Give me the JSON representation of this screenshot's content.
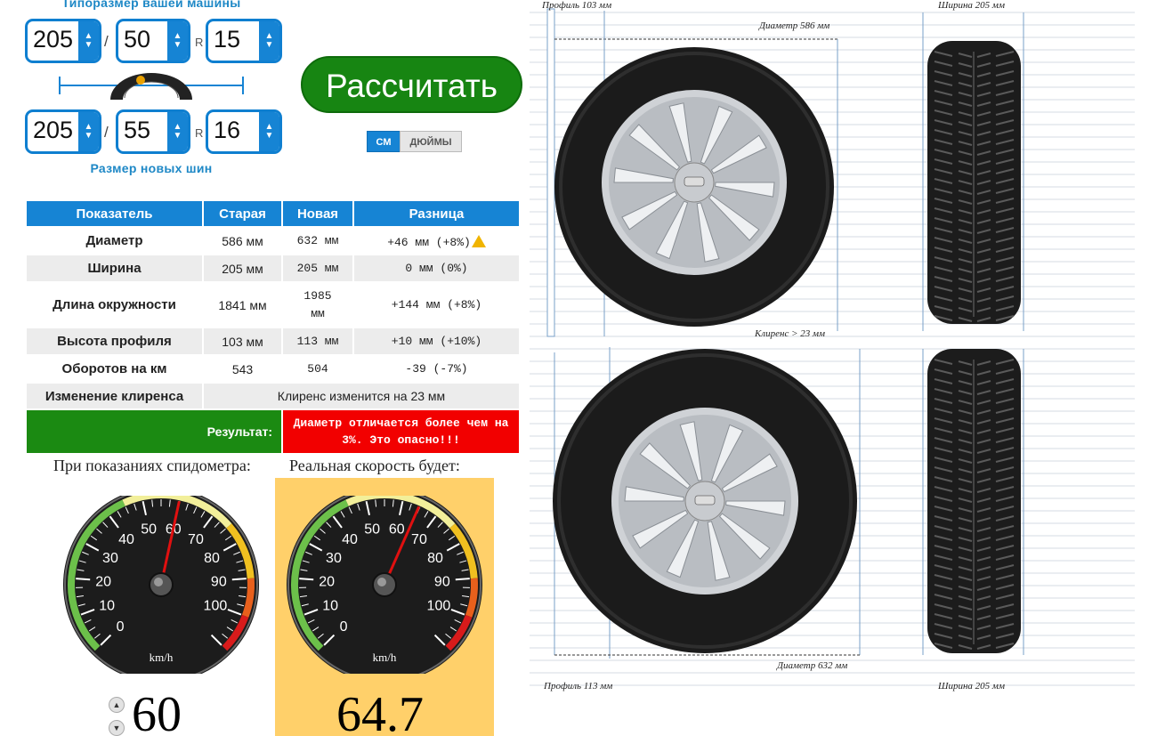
{
  "selectors": {
    "old_title": "Типоразмер вашей машины",
    "new_title": "Размер новых шин",
    "old": {
      "width": "205",
      "profile": "50",
      "rim": "15"
    },
    "new": {
      "width": "205",
      "profile": "55",
      "rim": "16"
    },
    "slash": "/",
    "r": "R",
    "spin_up": "▲",
    "spin_down": "▼"
  },
  "calc_button": "Рассчитать",
  "units": {
    "cm": "СМ",
    "inches": "ДЮЙМЫ"
  },
  "table": {
    "headers": [
      "Показатель",
      "Старая",
      "Новая",
      "Разница"
    ],
    "rows": [
      {
        "label": "Диаметр",
        "old": "586 мм",
        "new": "632 мм",
        "diff": "+46 мм (+8%)"
      },
      {
        "label": "Ширина",
        "old": "205 мм",
        "new": "205 мм",
        "diff": "0 мм (0%)"
      },
      {
        "label": "Длина окружности",
        "old": "1841 мм",
        "new": "1985 мм",
        "diff": "+144 мм (+8%)"
      },
      {
        "label": "Высота профиля",
        "old": "103 мм",
        "new": "113 мм",
        "diff": "+10 мм (+10%)"
      },
      {
        "label": "Оборотов на км",
        "old": "543",
        "new": "504",
        "diff": "-39 (-7%)"
      }
    ],
    "clearance_label": "Изменение клиренса",
    "clearance_text": "Клиренс изменится на 23 мм",
    "result_label": "Результат:",
    "result_text": "Диаметр отличается более чем на 3%. Это опасно!!!"
  },
  "speed": {
    "left_caption": "При показаниях спидометра:",
    "right_caption": "Реальная скорость будет:",
    "speedometer_value": "60",
    "real_value": "64.7",
    "speedometer_reading": 60,
    "real_reading": 64.7,
    "unit": "km/h",
    "ticks": [
      "0",
      "10",
      "20",
      "30",
      "40",
      "50",
      "60",
      "70",
      "80",
      "90",
      "100"
    ]
  },
  "diagram": {
    "old_profile": "Профиль 103 мм",
    "old_width": "Ширина 205 мм",
    "old_diameter": "Диаметр 586 мм",
    "clearance": "Клиренс > 23 мм",
    "new_diameter": "Диаметр 632 мм",
    "new_profile": "Профиль 113 мм",
    "new_width": "Ширина 205 мм"
  },
  "colors": {
    "accent": "#1684d4",
    "calc_button": "#178512",
    "result_ok": "#1b8a12",
    "result_danger": "#f20000",
    "real_panel": "#ffd06a"
  }
}
